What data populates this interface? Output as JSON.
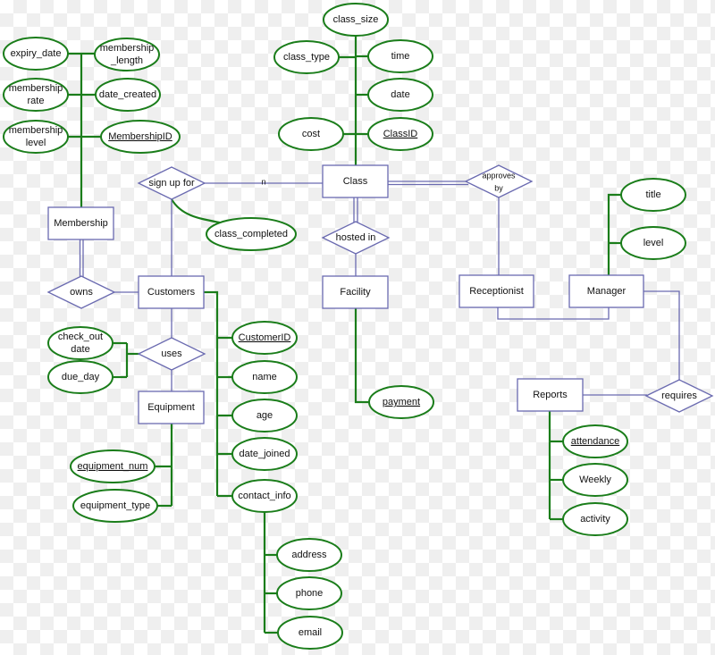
{
  "diagram": {
    "colors": {
      "entity_stroke": "#6a6ab0",
      "attribute_stroke": "#1a7d1a",
      "background": "#ffffff"
    },
    "entities": {
      "membership": "Membership",
      "customers": "Customers",
      "class": "Class",
      "facility": "Facility",
      "equipment": "Equipment",
      "receptionist": "Receptionist",
      "manager": "Manager",
      "reports": "Reports"
    },
    "relationships": {
      "sign_up_for": "sign up for",
      "owns": "owns",
      "hosted_in": "hosted in",
      "approves_by": [
        "approves",
        "by"
      ],
      "uses": "uses",
      "requires": "requires"
    },
    "cardinality": {
      "sign_up_for_class": "n"
    },
    "attributes": {
      "expiry_date": [
        "expiry_date"
      ],
      "membership_length": [
        "membership",
        "_length"
      ],
      "membership_rate": [
        "membership",
        "rate"
      ],
      "date_created": [
        "date_created"
      ],
      "membership_level": [
        "membership",
        "level"
      ],
      "membership_id": [
        "MembershipID"
      ],
      "class_size": [
        "class_size"
      ],
      "class_type": [
        "class_type"
      ],
      "time": [
        "time"
      ],
      "date": [
        "date"
      ],
      "cost": [
        "cost"
      ],
      "class_id": [
        "ClassID"
      ],
      "class_completed": [
        "class_completed"
      ],
      "check_out_date": [
        "check_out",
        "date"
      ],
      "due_day": [
        "due_day"
      ],
      "customer_id": [
        "CustomerID"
      ],
      "name": [
        "name"
      ],
      "age": [
        "age"
      ],
      "date_joined": [
        "date_joined"
      ],
      "contact_info": [
        "contact_info"
      ],
      "address": [
        "address"
      ],
      "phone": [
        "phone"
      ],
      "email": [
        "email"
      ],
      "equipment_num": [
        "equipment_num"
      ],
      "equipment_type": [
        "equipment_type"
      ],
      "payment": [
        "payment"
      ],
      "title": [
        "title"
      ],
      "level": [
        "level"
      ],
      "attendance": [
        "attendance"
      ],
      "weekly": [
        "Weekly"
      ],
      "activity": [
        "activity"
      ]
    },
    "key_attributes": [
      "membership_id",
      "class_id",
      "customer_id",
      "equipment_num",
      "payment",
      "attendance"
    ]
  }
}
